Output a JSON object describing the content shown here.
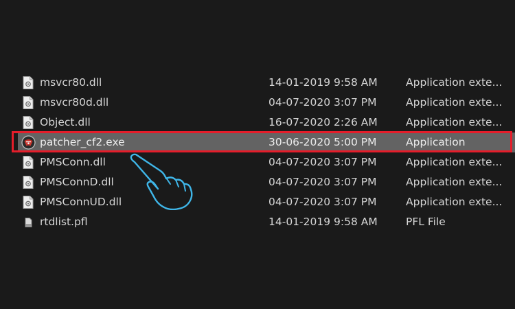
{
  "files": [
    {
      "name": "msvcr80.dll",
      "date": "14-01-2019 9:58 AM",
      "type": "Application exte...",
      "icon": "dll-file-icon"
    },
    {
      "name": "msvcr80d.dll",
      "date": "04-07-2020 3:07 PM",
      "type": "Application exte...",
      "icon": "dll-file-icon"
    },
    {
      "name": "Object.dll",
      "date": "16-07-2020 2:26 AM",
      "type": "Application exte...",
      "icon": "dll-file-icon"
    },
    {
      "name": "patcher_cf2.exe",
      "date": "30-06-2020 5:00 PM",
      "type": "Application",
      "icon": "patcher-app-icon",
      "selected": true
    },
    {
      "name": "PMSConn.dll",
      "date": "04-07-2020 3:07 PM",
      "type": "Application exte...",
      "icon": "dll-file-icon"
    },
    {
      "name": "PMSConnD.dll",
      "date": "04-07-2020 3:07 PM",
      "type": "Application exte...",
      "icon": "dll-file-icon"
    },
    {
      "name": "PMSConnUD.dll",
      "date": "04-07-2020 3:07 PM",
      "type": "Application exte...",
      "icon": "dll-file-icon"
    },
    {
      "name": "rtdlist.pfl",
      "date": "14-01-2019 9:58 AM",
      "type": "PFL File",
      "icon": "pfl-file-icon"
    }
  ],
  "colors": {
    "background": "#1a1a1a",
    "text": "#d6d6d6",
    "selected_row": "#636363",
    "highlight_border": "#e51d2a",
    "pointer_stroke": "#3fb6e8"
  },
  "annotation": {
    "highlight": "red-rectangle-around-selected-row",
    "pointer": "hand-pointer-icon"
  }
}
